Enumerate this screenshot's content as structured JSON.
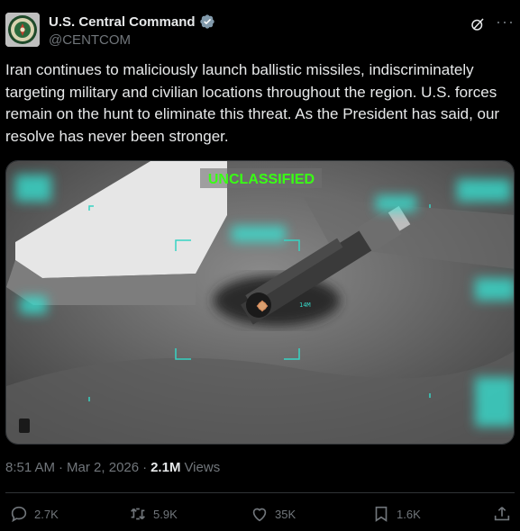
{
  "account": {
    "name": "U.S. Central Command",
    "handle": "@CENTCOM"
  },
  "post": {
    "text": "Iran continues to maliciously launch ballistic missiles, indiscriminately targeting military and civilian locations throughout the region. U.S. forces remain on the hunt to eliminate this threat. As the President has said, our resolve has never been stronger.",
    "media": {
      "banner": "UNCLASSIFIED",
      "hud_range": "14M"
    },
    "time": "8:51 AM",
    "date": "Mar 2, 2026",
    "views_count": "2.1M",
    "views_label": "Views"
  },
  "actions": {
    "replies": "2.7K",
    "reposts": "5.9K",
    "likes": "35K",
    "bookmarks": "1.6K"
  },
  "colors": {
    "verified": "#829aab",
    "banner_text": "#39ff14",
    "muted": "#71767b",
    "text": "#e7e9ea"
  }
}
